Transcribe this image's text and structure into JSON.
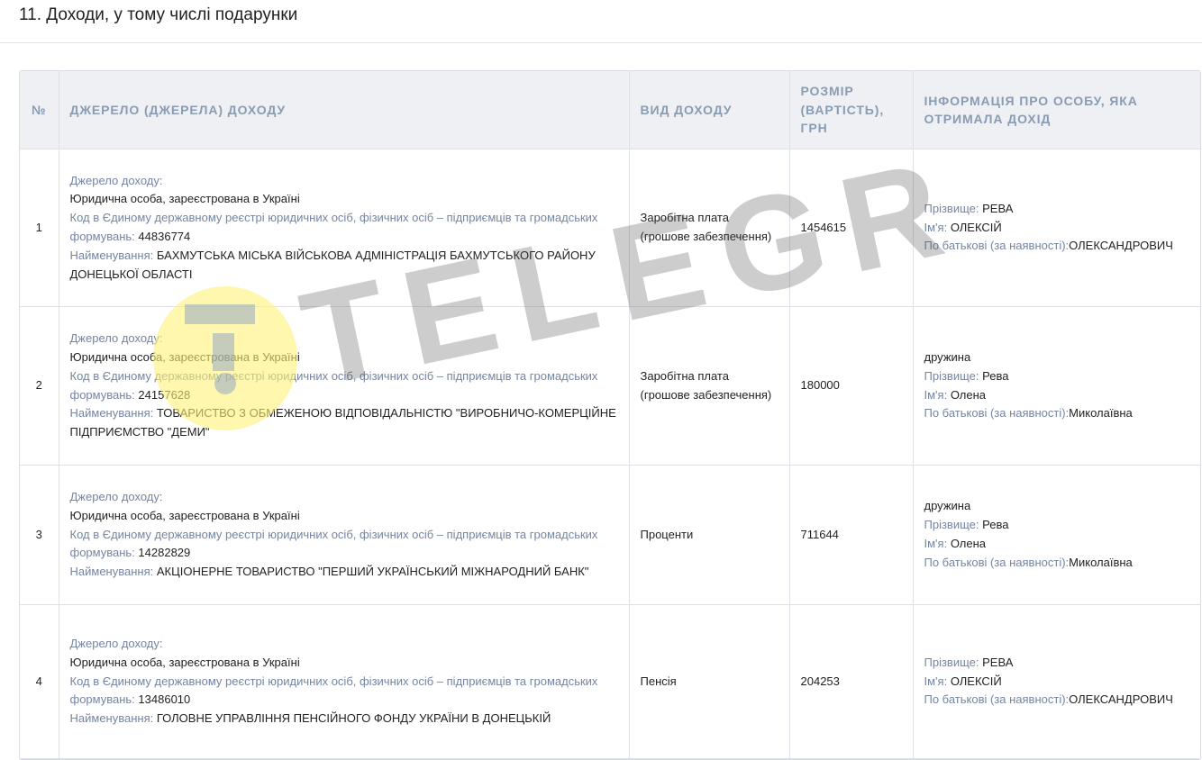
{
  "section": {
    "title": "11. Доходи, у тому числі подарунки"
  },
  "table": {
    "headers": {
      "num": "№",
      "source": "ДЖЕРЕЛО (ДЖЕРЕЛА) ДОХОДУ",
      "type": "ВИД ДОХОДУ",
      "amount": "РОЗМІР (ВАРТІСТЬ), ГРН",
      "recipient": "ІНФОРМАЦІЯ ПРО ОСОБУ, ЯКА ОТРИМАЛА ДОХІД"
    },
    "labels": {
      "source": "Джерело доходу:",
      "code": "Код в Єдиному державному реєстрі юридичних осіб, фізичних осіб – підприємців та громадських формувань:",
      "name": "Найменування:",
      "surname": "Прізвище:",
      "first_name": "Ім'я:",
      "patronymic": "По батькові (за наявності):"
    },
    "rows": [
      {
        "num": "1",
        "source_type": "Юридична особа, зареєстрована в Україні",
        "code": "44836774",
        "name": "БАХМУТСЬКА МІСЬКА ВІЙСЬКОВА АДМІНІСТРАЦІЯ БАХМУТСЬКОГО РАЙОНУ ДОНЕЦЬКОЇ ОБЛАСТІ",
        "income_type": "Заробітна плата (грошове забезпечення)",
        "amount": "1454615",
        "relation": "",
        "surname": "РЕВА",
        "first_name": "ОЛЕКСІЙ",
        "patronymic": "ОЛЕКСАНДРОВИЧ"
      },
      {
        "num": "2",
        "source_type": "Юридична особа, зареєстрована в Україні",
        "code": "24157628",
        "name": "ТОВАРИСТВО З ОБМЕЖЕНОЮ ВІДПОВІДАЛЬНІСТЮ \"ВИРОБНИЧО-КОМЕРЦІЙНЕ ПІДПРИЄМСТВО \"ДЕМИ\"",
        "income_type": "Заробітна плата (грошове забезпечення)",
        "amount": "180000",
        "relation": "дружина",
        "surname": "Рева",
        "first_name": "Олена",
        "patronymic": "Миколаївна"
      },
      {
        "num": "3",
        "source_type": "Юридична особа, зареєстрована в Україні",
        "code": "14282829",
        "name": "АКЦІОНЕРНЕ ТОВАРИСТВО \"ПЕРШИЙ УКРАЇНСЬКИЙ МІЖНАРОДНИЙ БАНК\"",
        "income_type": "Проценти",
        "amount": "711644",
        "relation": "дружина",
        "surname": "Рева",
        "first_name": "Олена",
        "patronymic": "Миколаївна"
      },
      {
        "num": "4",
        "source_type": "Юридична особа, зареєстрована в Україні",
        "code": "13486010",
        "name": "ГОЛОВНЕ УПРАВЛІННЯ ПЕНСІЙНОГО ФОНДУ УКРАЇНИ В ДОНЕЦЬКІЙ",
        "income_type": "Пенсія",
        "amount": "204253",
        "relation": "",
        "surname": "РЕВА",
        "first_name": "ОЛЕКСІЙ",
        "patronymic": "ОЛЕКСАНДРОВИЧ"
      }
    ]
  },
  "watermark": {
    "text": "TELEGRAF"
  },
  "colors": {
    "header_text": "#8a9bb4",
    "label_text": "#7485a3",
    "header_bg": "#eef0f3",
    "watermark_yellow": "#fff176",
    "watermark_blue": "#7f97cf",
    "watermark_gray": "#4a4a4a"
  }
}
